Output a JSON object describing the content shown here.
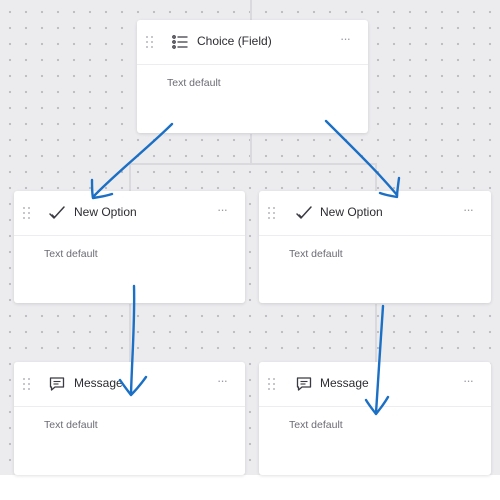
{
  "nodes": [
    {
      "title": "Choice (Field)",
      "icon": "list-icon",
      "body": "Text default"
    },
    {
      "title": "New Option",
      "icon": "checkmark-icon",
      "body": "Text default"
    },
    {
      "title": "New Option",
      "icon": "checkmark-icon",
      "body": "Text default"
    },
    {
      "title": "Message",
      "icon": "chat-bubble-icon",
      "body": "Text default"
    },
    {
      "title": "Message",
      "icon": "chat-bubble-icon",
      "body": "Text default"
    }
  ],
  "more_menu_glyph": "···",
  "colors": {
    "canvas": "#ececef",
    "card": "#ffffff",
    "arrow": "#1b6fc4",
    "connector": "#d9d9de"
  }
}
